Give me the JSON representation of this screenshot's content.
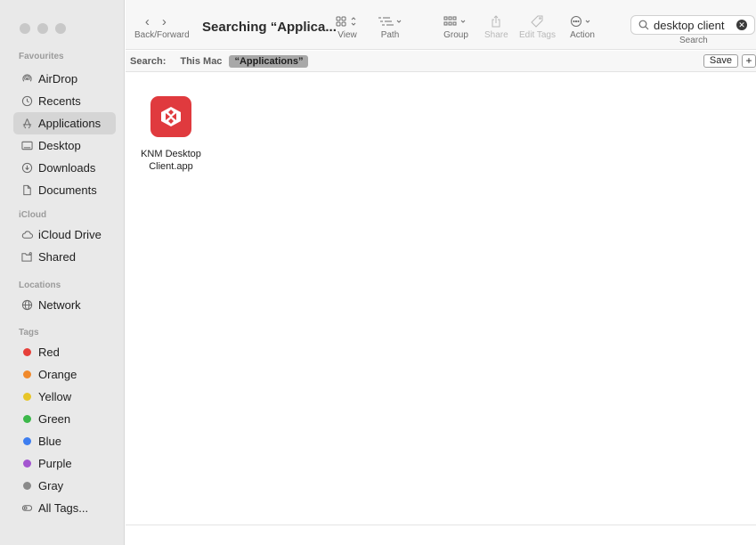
{
  "window": {
    "title": "Searching “Applica..."
  },
  "toolbar": {
    "back_forward_label": "Back/Forward",
    "view_label": "View",
    "path_label": "Path",
    "group_label": "Group",
    "share_label": "Share",
    "edit_tags_label": "Edit Tags",
    "action_label": "Action",
    "search_value": "desktop client",
    "search_label": "Search"
  },
  "scope": {
    "label": "Search:",
    "this_mac": "This Mac",
    "applications": "“Applications”",
    "save": "Save",
    "plus": "+"
  },
  "sidebar": {
    "favourites_header": "Favourites",
    "favourites": [
      {
        "label": "AirDrop",
        "icon": "airdrop-icon"
      },
      {
        "label": "Recents",
        "icon": "clock-icon"
      },
      {
        "label": "Applications",
        "icon": "applications-icon",
        "selected": true
      },
      {
        "label": "Desktop",
        "icon": "desktop-icon"
      },
      {
        "label": "Downloads",
        "icon": "download-icon"
      },
      {
        "label": "Documents",
        "icon": "document-icon"
      }
    ],
    "icloud_header": "iCloud",
    "icloud": [
      {
        "label": "iCloud Drive",
        "icon": "cloud-icon"
      },
      {
        "label": "Shared",
        "icon": "shared-folder-icon"
      }
    ],
    "locations_header": "Locations",
    "locations": [
      {
        "label": "Network",
        "icon": "network-icon"
      }
    ],
    "tags_header": "Tags",
    "tags": [
      {
        "label": "Red",
        "color": "#e6403a"
      },
      {
        "label": "Orange",
        "color": "#f0892b"
      },
      {
        "label": "Yellow",
        "color": "#e7c528"
      },
      {
        "label": "Green",
        "color": "#3cb84a"
      },
      {
        "label": "Blue",
        "color": "#3e7ef0"
      },
      {
        "label": "Purple",
        "color": "#a355d0"
      },
      {
        "label": "Gray",
        "color": "#8a8a8a"
      }
    ],
    "all_tags": "All Tags..."
  },
  "files": [
    {
      "name_line1": "KNM Desktop",
      "name_line2": "Client.app",
      "icon_color": "#e03a3e"
    }
  ]
}
